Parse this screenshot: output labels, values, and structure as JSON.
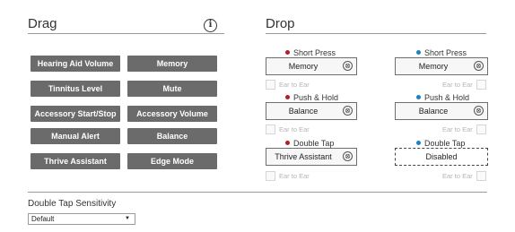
{
  "drag": {
    "title": "Drag",
    "info_glyph": "i",
    "buttons": [
      "Hearing Aid Volume",
      "Memory",
      "Tinnitus Level",
      "Mute",
      "Accessory Start/Stop",
      "Accessory Volume",
      "Manual Alert",
      "Balance",
      "Thrive Assistant",
      "Edge Mode"
    ]
  },
  "drop": {
    "title": "Drop",
    "clear_glyph": "⊗",
    "ear_to_ear": "Ear to Ear",
    "left_color": "#b11e24",
    "right_color": "#1d7fc4",
    "rows": [
      {
        "left_label": "Short Press",
        "left_value": "Memory",
        "right_label": "Short Press",
        "right_value": "Memory"
      },
      {
        "left_label": "Push & Hold",
        "left_value": "Balance",
        "right_label": "Push & Hold",
        "right_value": "Balance"
      },
      {
        "left_label": "Double Tap",
        "left_value": "Thrive Assistant",
        "right_label": "Double Tap",
        "right_value": "Disabled"
      }
    ]
  },
  "sensitivity": {
    "label": "Double Tap Sensitivity",
    "selected": "Default"
  }
}
